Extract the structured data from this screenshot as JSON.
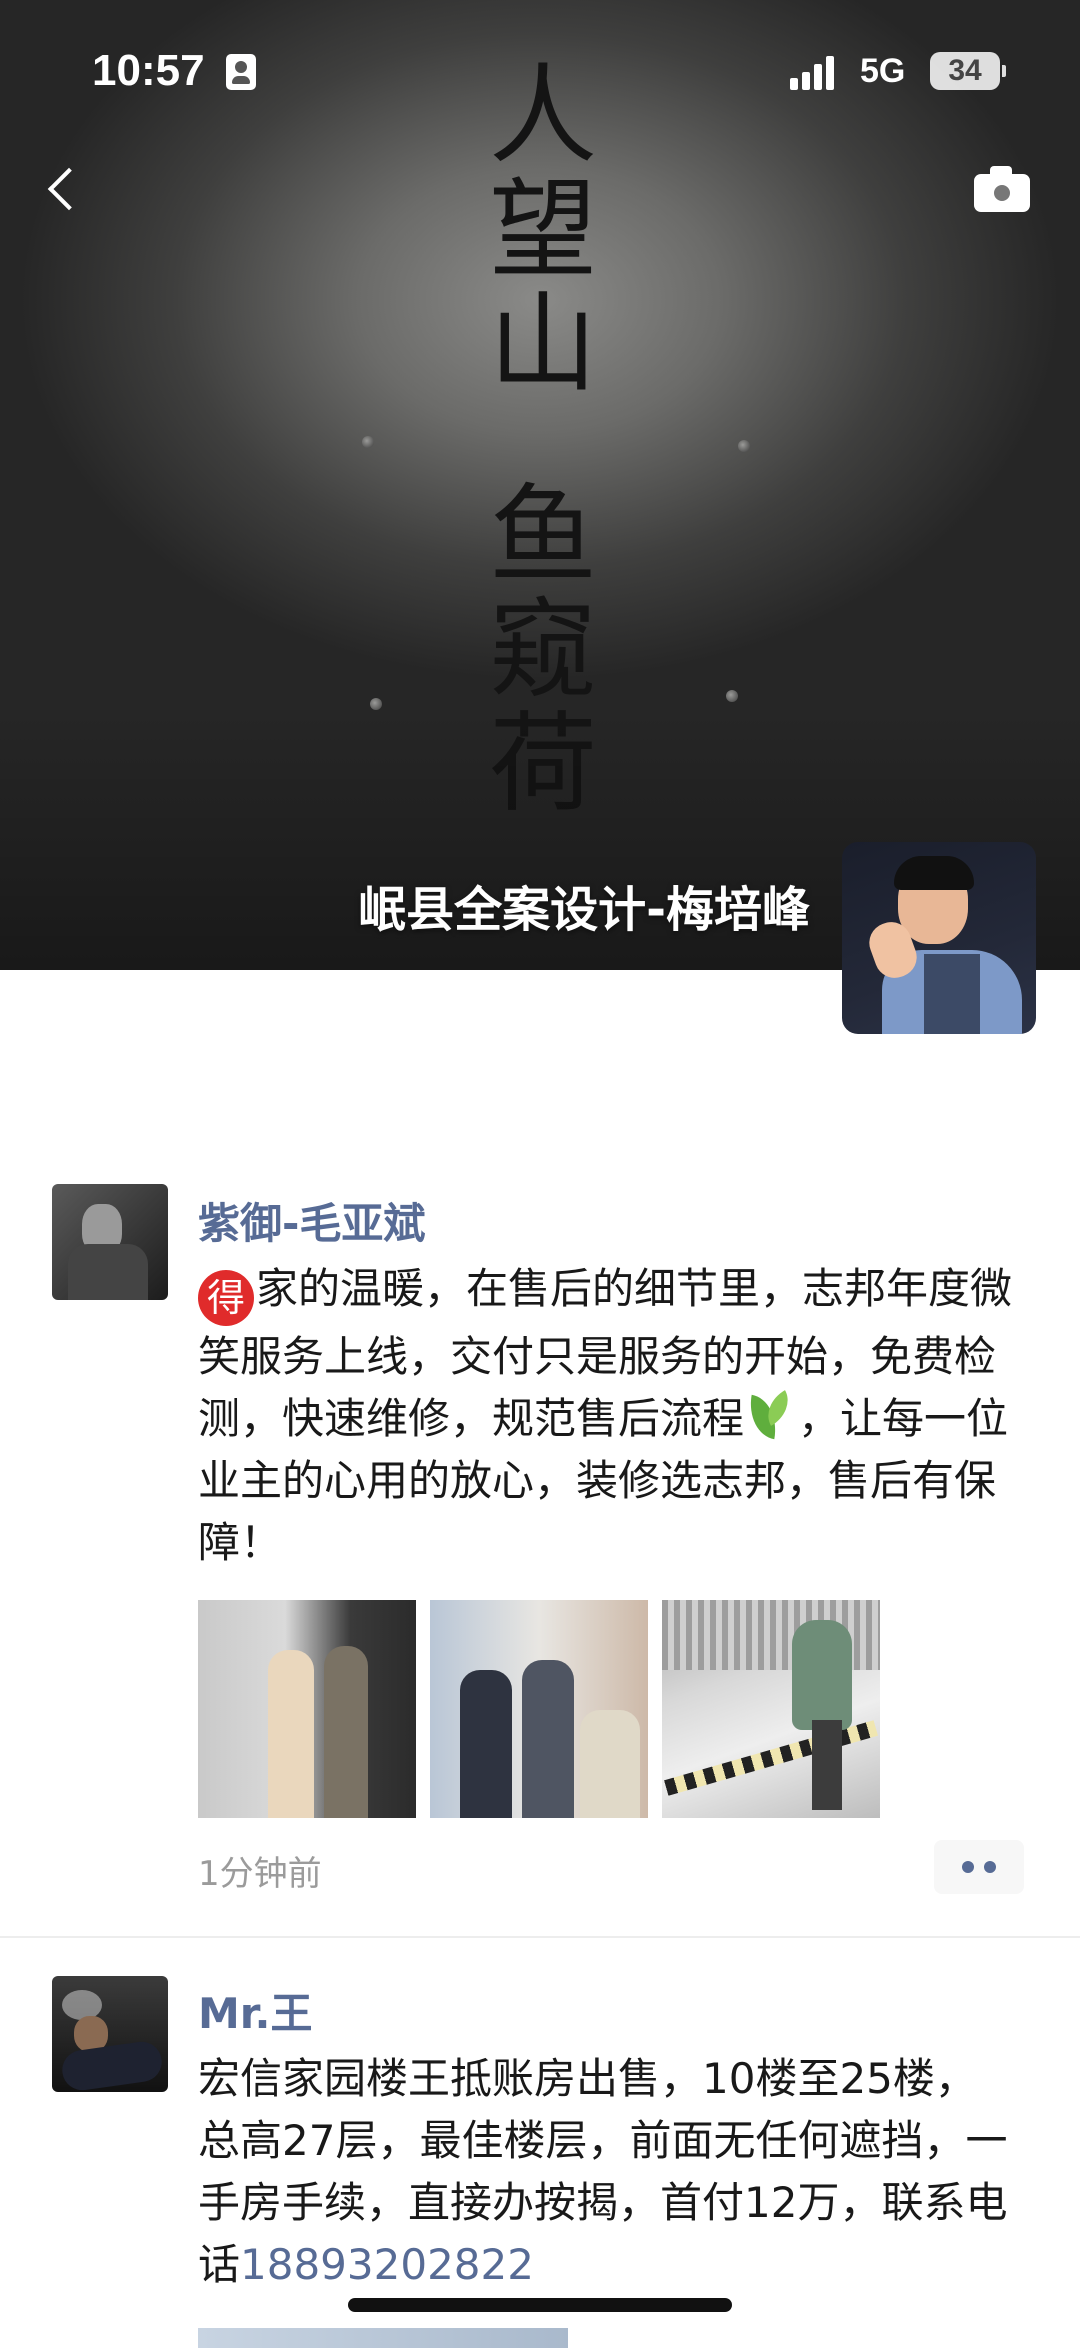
{
  "status_bar": {
    "time": "10:57",
    "network": "5G",
    "battery": "34"
  },
  "cover": {
    "wall_text_line1": "人望山",
    "wall_text_line2": "鱼窥荷"
  },
  "profile": {
    "name": "岷县全案设计-梅培峰"
  },
  "posts": [
    {
      "author": "紫御-毛亚斌",
      "emoji_start": "得",
      "text_part1": "家的温暖，在售后的细节里，志邦年度微笑服务上线，交付只是服务的开始，免费检测，快速维修，规范售后流程",
      "text_part2": "，让每一位业主的心用的放心，装修选志邦，售后有保障！",
      "time": "1分钟前"
    },
    {
      "author": "Mr.王",
      "text": "宏信家园楼王抵账房出售，10楼至25楼，总高27层，最佳楼层，前面无任何遮挡，一手房手续，直接办按揭，首付12万，联系电话",
      "phone": "18893202822"
    }
  ],
  "icons": {
    "back": "chevron-left-icon",
    "camera": "camera-icon",
    "more": "more-dots-icon"
  },
  "colors": {
    "link": "#576b95",
    "timestamp": "#9b9b9b",
    "emoji_red": "#e02b2b"
  }
}
